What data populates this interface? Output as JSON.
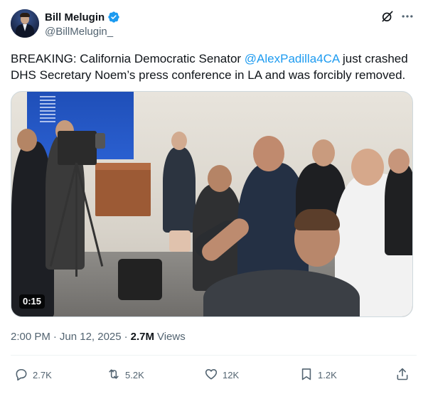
{
  "author": {
    "display_name": "Bill Melugin",
    "handle": "@BillMelugin_",
    "verified": true
  },
  "tweet": {
    "text_before_mention": "BREAKING: California Democratic Senator ",
    "mention": "@AlexPadilla4CA",
    "text_after_mention": " just crashed DHS Secretary Noem’s press conference in LA and was forcibly removed."
  },
  "media": {
    "type": "video",
    "duration": "0:15"
  },
  "meta": {
    "time": "2:00 PM",
    "separator": "·",
    "date": "Jun 12, 2025",
    "separator2": "·",
    "views_count": "2.7M",
    "views_label": "Views"
  },
  "actions": {
    "reply_count": "2.7K",
    "retweet_count": "5.2K",
    "like_count": "12K",
    "bookmark_count": "1.2K"
  },
  "icons": {
    "verified": "verified-badge-icon",
    "grok": "grok-icon",
    "more": "more-dots-icon",
    "reply": "reply-icon",
    "retweet": "retweet-icon",
    "like": "heart-icon",
    "bookmark": "bookmark-icon",
    "share": "share-icon"
  },
  "colors": {
    "accent": "#1d9bf0",
    "text_primary": "#0f1419",
    "text_secondary": "#536471"
  }
}
